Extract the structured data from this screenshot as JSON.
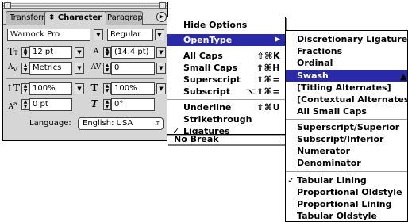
{
  "palette": {
    "tabs": [
      "Transform",
      "⬍ Character",
      "Paragraph"
    ],
    "font_family": "Warnock Pro",
    "font_style": "Regular",
    "font_size": "12 pt",
    "leading": "(14.4 pt)",
    "kerning": "Metrics",
    "tracking": "0",
    "vertical_scale": "100%",
    "horizontal_scale": "100%",
    "baseline_shift": "0 pt",
    "skew": "0°",
    "language_label": "Language:",
    "language_value": "English: USA"
  },
  "menu1": {
    "items": [
      {
        "label": "Hide Options",
        "shortcut": ""
      },
      {
        "label": "OpenType",
        "shortcut": "",
        "has_submenu": true,
        "highlighted": true
      },
      {
        "label": "All Caps",
        "shortcut": "⇧⌘K"
      },
      {
        "label": "Small Caps",
        "shortcut": "⇧⌘H"
      },
      {
        "label": "Superscript",
        "shortcut": "⇧⌘="
      },
      {
        "label": "Subscript",
        "shortcut": "⌥⇧⌘="
      },
      {
        "label": "Underline",
        "shortcut": "⇧⌘U"
      },
      {
        "label": "Strikethrough",
        "shortcut": ""
      },
      {
        "label": "Ligatures",
        "shortcut": "",
        "checked": true
      },
      {
        "label": "No Break",
        "shortcut": ""
      }
    ],
    "check_glyph": "✓"
  },
  "menu2": {
    "items": [
      {
        "label": "Discretionary Ligatures"
      },
      {
        "label": "Fractions"
      },
      {
        "label": "Ordinal"
      },
      {
        "label": "Swash",
        "highlighted": true
      },
      {
        "label": "[Titling Alternates]"
      },
      {
        "label": "[Contextual Alternates]"
      },
      {
        "label": "All Small Caps"
      },
      {
        "label": "Superscript/Superior"
      },
      {
        "label": "Subscript/Inferior"
      },
      {
        "label": "Numerator"
      },
      {
        "label": "Denominator"
      },
      {
        "label": "Tabular Lining",
        "checked": true
      },
      {
        "label": "Proportional Oldstyle"
      },
      {
        "label": "Proportional Lining"
      },
      {
        "label": "Tabular Oldstyle"
      }
    ]
  },
  "colors": {
    "highlight": "#2a2aa8",
    "panel": "#d6d6d6"
  }
}
